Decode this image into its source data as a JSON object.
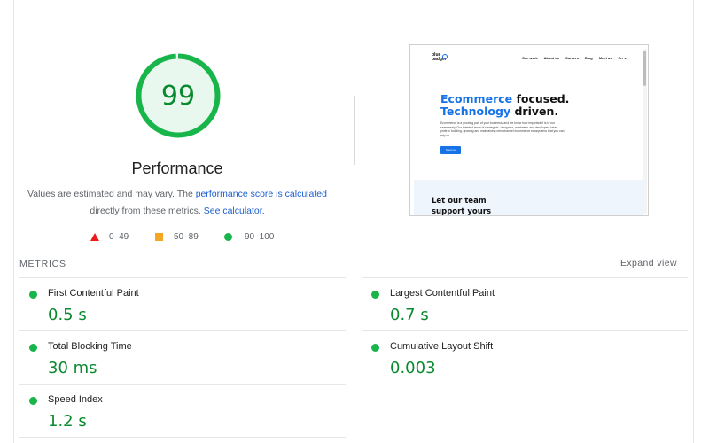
{
  "performance": {
    "score": "99",
    "score_fraction": 0.99,
    "title": "Performance",
    "description_prefix": "Values are estimated and may vary. The ",
    "score_link": "performance score is calculated",
    "description_middle": "directly from these metrics. ",
    "calculator_link": "See calculator."
  },
  "legend": {
    "fail": "0–49",
    "average": "50–89",
    "pass": "90–100"
  },
  "colors": {
    "pass": "#18b54a",
    "pass_text": "#0a8a2e",
    "average": "#f5a623",
    "fail": "#ea1c1c",
    "link": "#1a5fd1"
  },
  "screenshot": {
    "logo_line1": "blue",
    "logo_line2": "badger",
    "nav": [
      "Our work",
      "About us",
      "Careers",
      "Blog",
      "Meet us",
      "En ⌄"
    ],
    "hero_blue1": "Ecommerce",
    "hero_black1": " focused.",
    "hero_blue2": "Technology",
    "hero_black2": " driven.",
    "hero_body": "Ecommerce is a growing part of your business, and we know how important it is to run seamlessly. Our talented team of strategists, designers, marketers and developers takes pride in building, growing and maintaining omnichannel ecommerce ecosystems that you can rely on.",
    "hero_button": "Meet us",
    "band_line1": "Let our team",
    "band_line2": "support yours"
  },
  "metrics": {
    "label": "METRICS",
    "expand": "Expand view",
    "items": [
      {
        "name": "First Contentful Paint",
        "value": "0.5 s"
      },
      {
        "name": "Largest Contentful Paint",
        "value": "0.7 s"
      },
      {
        "name": "Total Blocking Time",
        "value": "30 ms"
      },
      {
        "name": "Cumulative Layout Shift",
        "value": "0.003"
      },
      {
        "name": "Speed Index",
        "value": "1.2 s"
      }
    ]
  }
}
